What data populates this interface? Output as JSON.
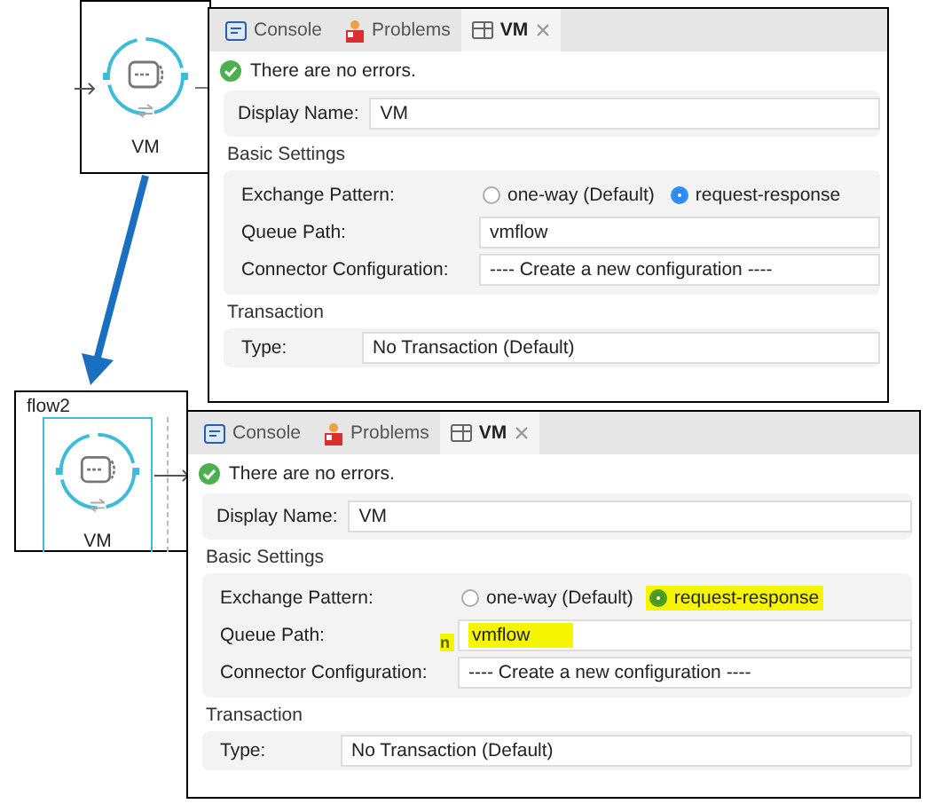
{
  "top_node": {
    "label": "VM"
  },
  "flow": {
    "title": "flow2",
    "node": {
      "label": "VM"
    }
  },
  "panels": [
    {
      "tabs": [
        {
          "label": "Console",
          "kind": "console",
          "selected": false
        },
        {
          "label": "Problems",
          "kind": "problems",
          "selected": false
        },
        {
          "label": "VM",
          "kind": "editor",
          "selected": true
        }
      ],
      "status": "There are no errors.",
      "display_name": {
        "label": "Display Name:",
        "value": "VM"
      },
      "basic_settings": {
        "title": "Basic Settings",
        "exchange_pattern": {
          "label": "Exchange Pattern:",
          "options": [
            {
              "label": "one-way (Default)",
              "selected": false,
              "highlighted": false
            },
            {
              "label": "request-response",
              "selected": true,
              "highlighted": false
            }
          ]
        },
        "queue_path": {
          "label": "Queue Path:",
          "value": "vmflow",
          "highlighted": false
        },
        "connector_configuration": {
          "label": "Connector Configuration:",
          "value": "---- Create a new configuration ----"
        }
      },
      "transaction": {
        "title": "Transaction",
        "type": {
          "label": "Type:",
          "value": "No Transaction (Default)"
        }
      }
    },
    {
      "tabs": [
        {
          "label": "Console",
          "kind": "console",
          "selected": false
        },
        {
          "label": "Problems",
          "kind": "problems",
          "selected": false
        },
        {
          "label": "VM",
          "kind": "editor",
          "selected": true
        }
      ],
      "status": "There are no errors.",
      "display_name": {
        "label": "Display Name:",
        "value": "VM"
      },
      "basic_settings": {
        "title": "Basic Settings",
        "exchange_pattern": {
          "label": "Exchange Pattern:",
          "options": [
            {
              "label": "one-way (Default)",
              "selected": false,
              "highlighted": false
            },
            {
              "label": "request-response",
              "selected": true,
              "highlighted": true
            }
          ]
        },
        "queue_path": {
          "label": "Queue Path:",
          "marker": "n",
          "value": "vmflow",
          "highlighted": true
        },
        "connector_configuration": {
          "label": "Connector Configuration:",
          "value": "---- Create a new configuration ----"
        }
      },
      "transaction": {
        "title": "Transaction",
        "type": {
          "label": "Type:",
          "value": "No Transaction (Default)"
        }
      }
    }
  ]
}
